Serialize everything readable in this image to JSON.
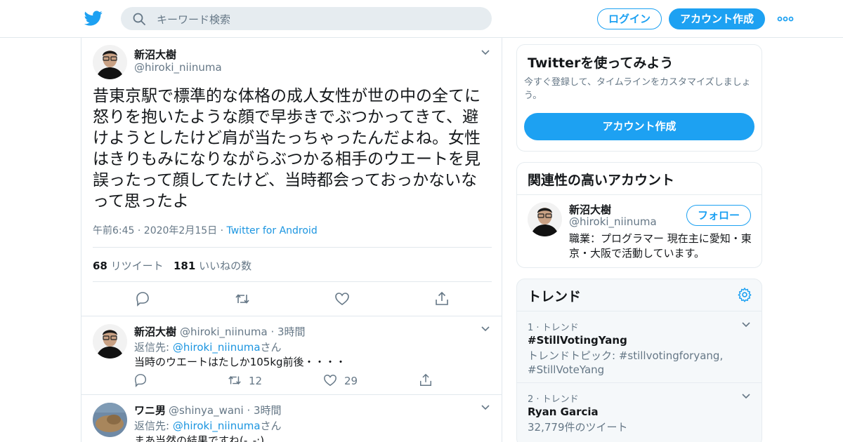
{
  "header": {
    "search_placeholder": "キーワード検索",
    "login_label": "ログイン",
    "signup_label": "アカウント作成"
  },
  "tweet": {
    "author_name": "新沼大樹",
    "author_handle": "@hiroki_niinuma",
    "text": "昔東京駅で標準的な体格の成人女性が世の中の全てに怒りを抱いたような顔で早歩きでぶつかってきて、避けようとしたけど肩が当たっちゃったんだよね。女性はきりもみになりながらぶつかる相手のウエートを見誤ったって顔してたけど、当時都会っておっかないなって思ったよ",
    "timestamp": "午前6:45 · 2020年2月15日",
    "sep": " · ",
    "source": "Twitter for Android",
    "retweet_count": "68",
    "retweet_label": "リツイート",
    "like_count": "181",
    "like_label": "いいねの数"
  },
  "replies": [
    {
      "name": "新沼大樹",
      "meta": "@hiroki_niinuma · 3時間",
      "reply_prefix": "返信先: ",
      "reply_to": "@hiroki_niinuma",
      "reply_suffix": "さん",
      "text": "当時のウエートはたしか105kg前後・・・・",
      "retweets": "12",
      "likes": "29"
    },
    {
      "name": "ワニ男",
      "meta": "@shinya_wani · 3時間",
      "reply_prefix": "返信先: ",
      "reply_to": "@hiroki_niinuma",
      "reply_suffix": "さん",
      "text": "まあ当然の結果ですね(-_-;)"
    }
  ],
  "sidebar": {
    "signup_card": {
      "title": "Twitterを使ってみよう",
      "desc": "今すぐ登録して、タイムラインをカスタマイズしましょう。",
      "button": "アカウント作成"
    },
    "related": {
      "title": "関連性の高いアカウント",
      "name": "新沼大樹",
      "handle": "@hiroki_niinuma",
      "follow": "フォロー",
      "bio": "職業：プログラマー 現在主に愛知・東京・大阪で活動しています。"
    },
    "trends": {
      "title": "トレンド",
      "items": [
        {
          "rank": "1 · トレンド",
          "name": "#StillVotingYang",
          "desc": "トレンドトピック: #stillvotingforyang, #StillVoteYang"
        },
        {
          "rank": "2 · トレンド",
          "name": "Ryan Garcia",
          "desc": "32,779件のツイート"
        }
      ]
    }
  },
  "colors": {
    "accent": "#1da1f2",
    "link": "#1b95e0",
    "muted": "#657786",
    "text": "#14171a",
    "border": "#e1e8ed"
  }
}
